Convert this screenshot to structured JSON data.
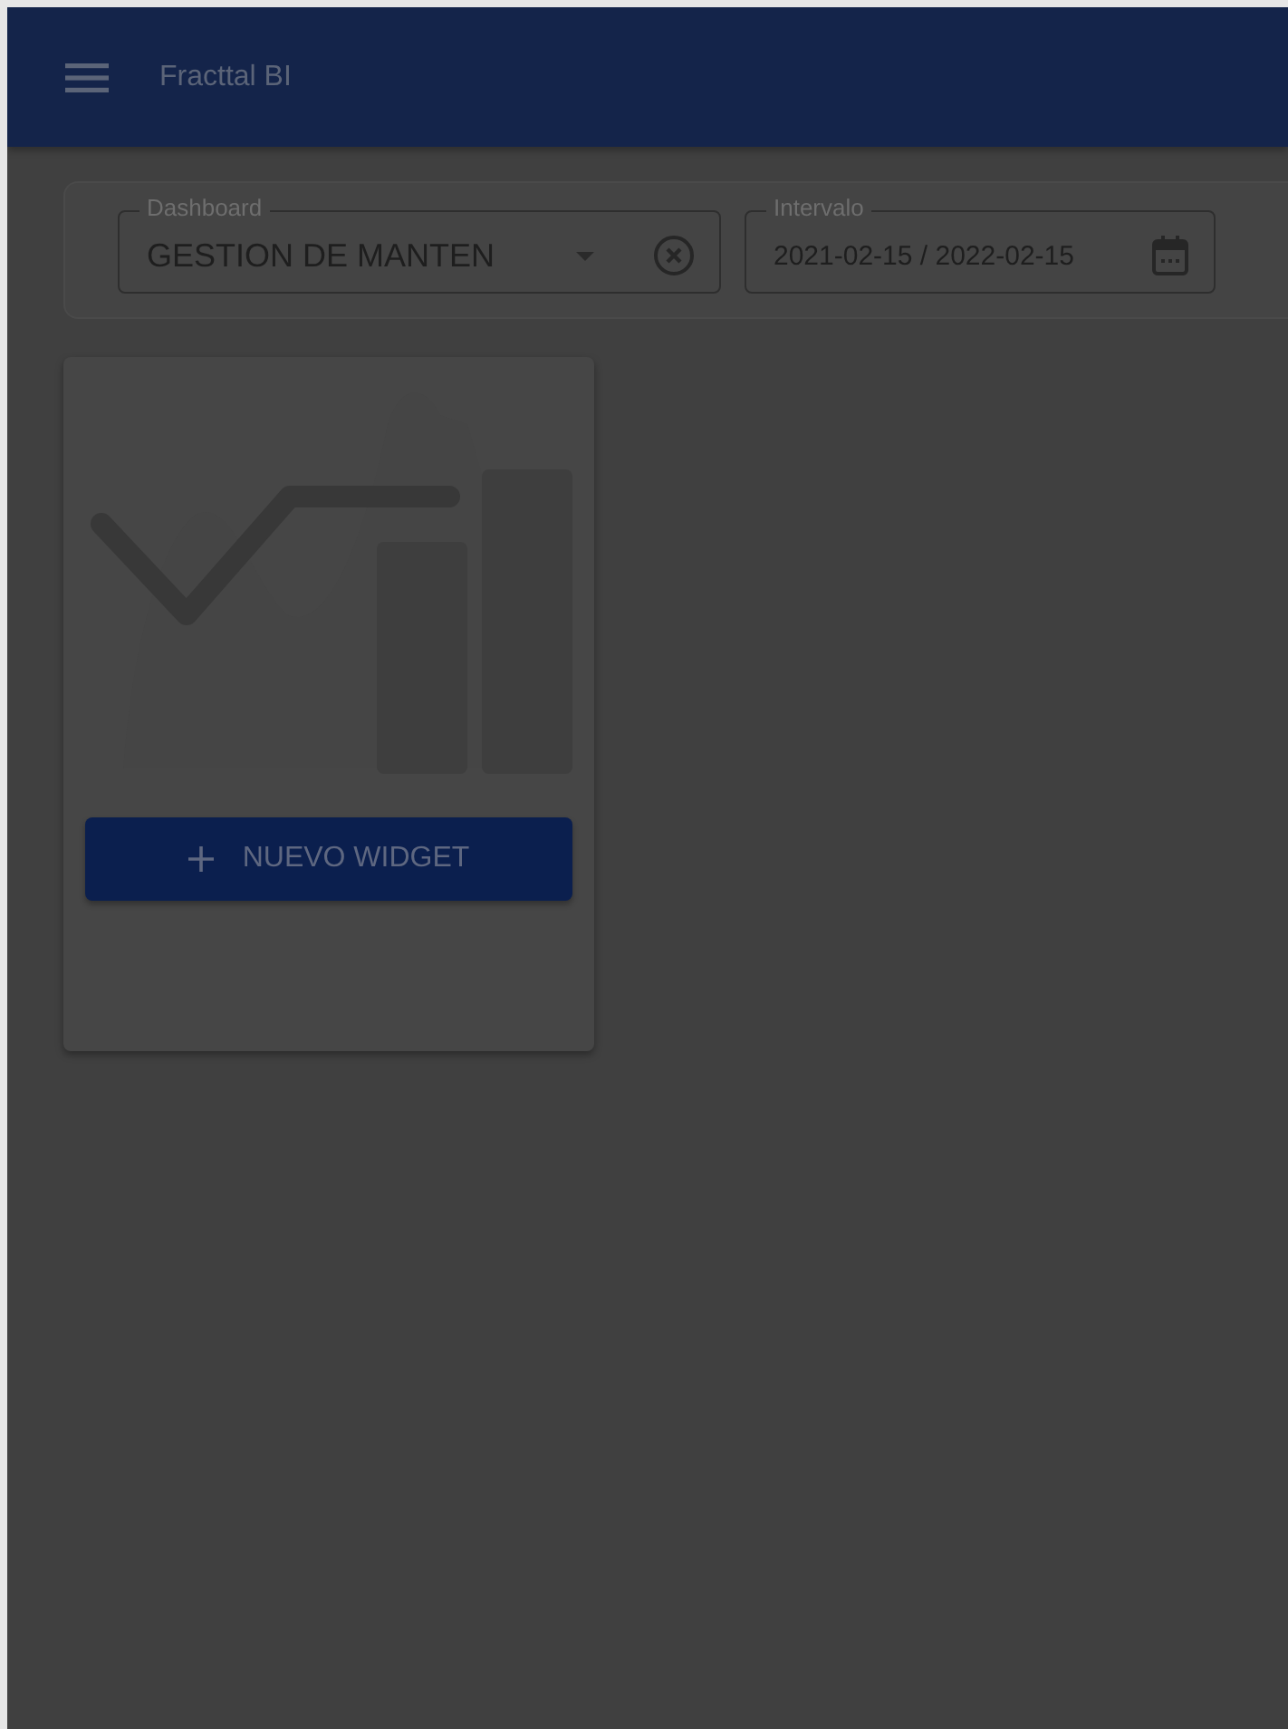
{
  "app_bar": {
    "title": "Fracttal BI"
  },
  "filters": [
    {
      "kind": "select",
      "label": "Dashboard",
      "value": "GESTION DE MANTEN"
    },
    {
      "kind": "date",
      "label": "Intervalo",
      "value": "2021-02-15 / 2022-02-15"
    }
  ],
  "empty_card": {
    "button": "NUEVO WIDGET"
  }
}
